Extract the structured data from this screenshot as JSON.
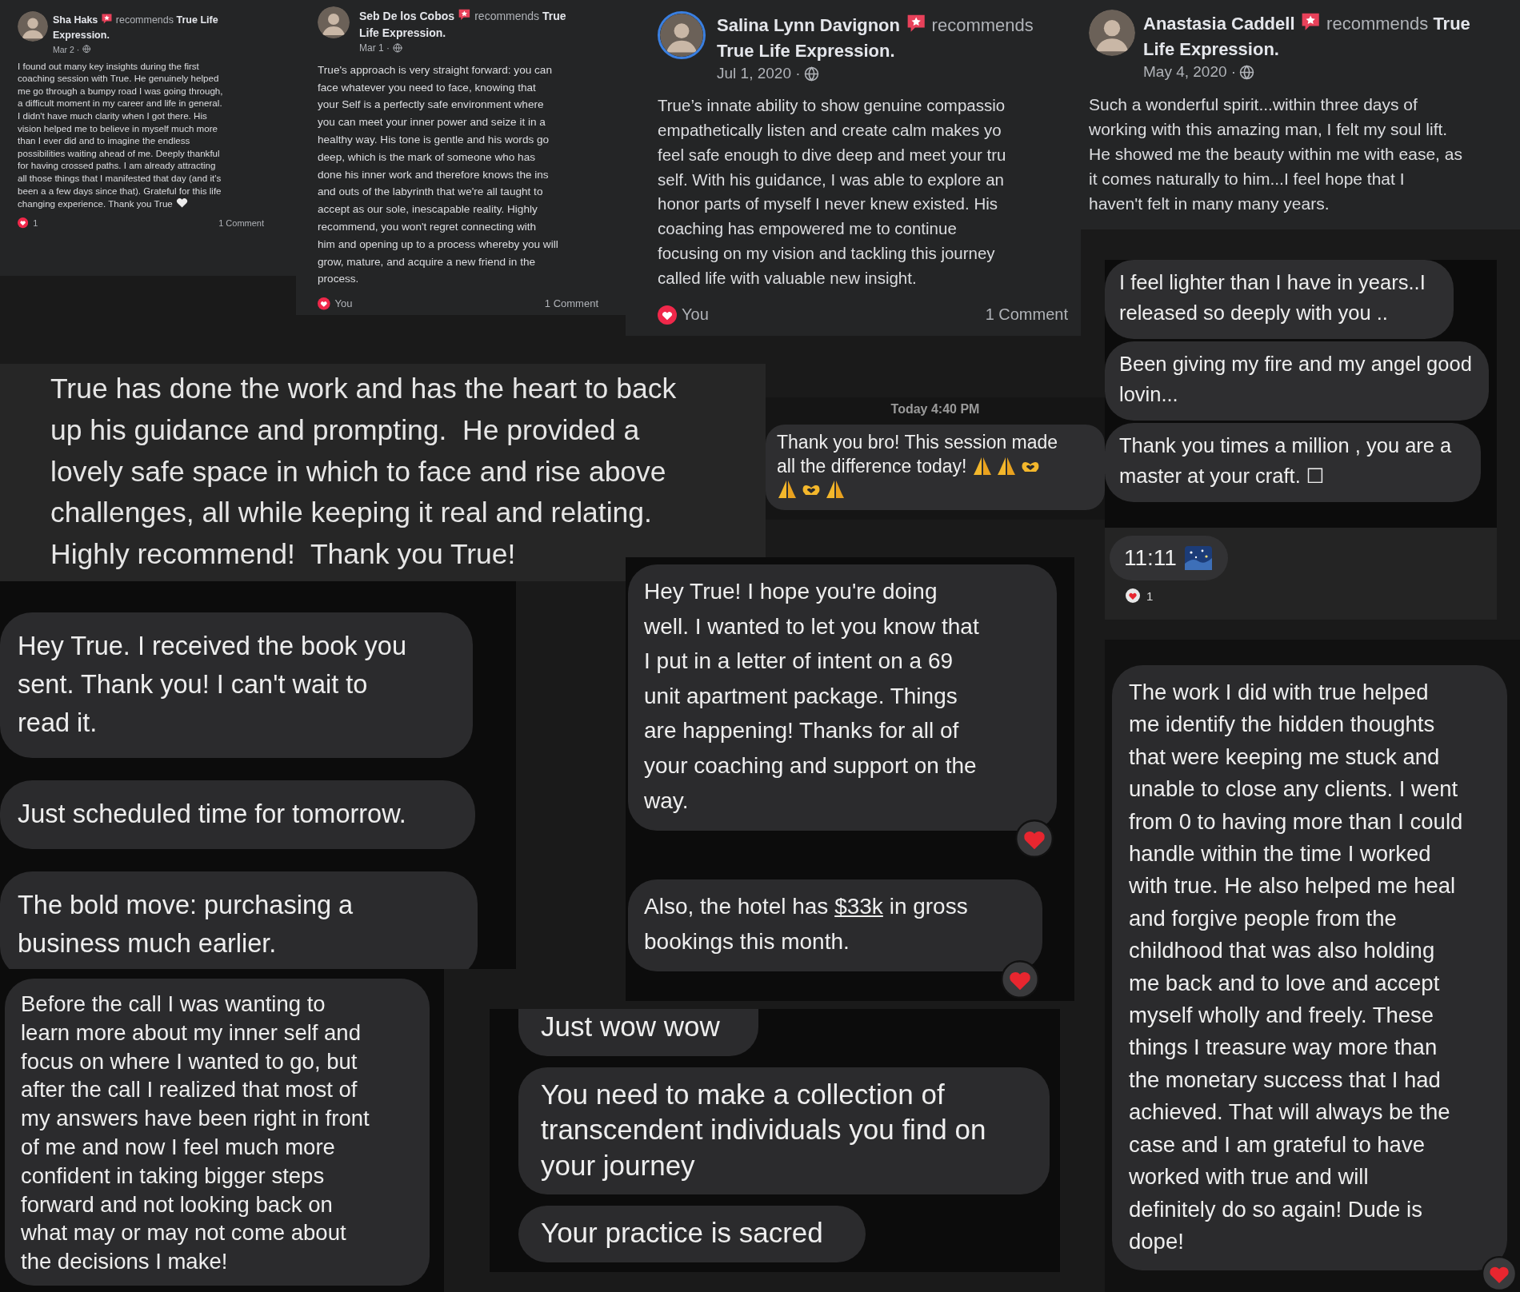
{
  "recommendations": [
    {
      "author": "Sha Haks",
      "action": "recommends **True Life**",
      "action_continued": "Expression.",
      "date": "Mar 2 ·",
      "lines": [
        "I found out many key insights during the first",
        "coaching session with True. He genuinely helped",
        "me go through a bumpy road I was going through,",
        "a difficult moment in my career and life in general.",
        "I didn't have much clarity when I got there. His",
        "vision helped me to believe in myself much more",
        "than I ever did and to imagine the endless",
        "possibilities waiting ahead of me. Deeply thankful",
        "for having crossed paths. I am already attracting",
        "all those things that I manifested that day (and it's",
        "been a a few days since that). Grateful for this life",
        "changing experience. Thank you True"
      ],
      "white_heart": true,
      "reactions": "1",
      "comments": "1 Comment",
      "avatar_ring": false
    },
    {
      "author": "Seb De los Cobos",
      "action": "recommends **True**",
      "action_continued": "Life Expression.",
      "date": "Mar 1 ·",
      "lines": [
        "True's approach is very straight forward: you can",
        "face whatever you need to face, knowing that",
        "your Self is a perfectly safe environment where",
        "you can meet your inner power and seize it in a",
        "healthy way. His tone is gentle and his words go",
        "deep, which is the mark of someone who has",
        "done his inner work and therefore knows the ins",
        "and outs of the labyrinth that we're all taught to",
        "accept as our sole, inescapable reality. Highly",
        "recommend, you won't regret connecting with",
        "him and opening up to a process whereby you will",
        "grow, mature, and acquire a new friend in the",
        "process."
      ],
      "white_heart": false,
      "reactions": "You",
      "comments": "1 Comment",
      "avatar_ring": false
    },
    {
      "author": "Salina Lynn Davignon",
      "action": "recommends",
      "action_continued": "True Life Expression.",
      "date": "Jul 1, 2020 ·",
      "lines": [
        "True’s innate ability to show genuine compassio",
        "empathetically listen and create calm makes yo",
        "feel safe enough to dive deep and meet your tru",
        "self. With his guidance, I was able to explore an",
        "honor parts of myself I never knew existed. His",
        "coaching has empowered me to continue",
        "focusing on my vision and tackling this journey",
        "called life with valuable new insight."
      ],
      "white_heart": false,
      "reactions": "You",
      "comments": "1 Comment",
      "avatar_ring": true
    },
    {
      "author": "Anastasia Caddell",
      "action": "recommends **True**",
      "action_continued": "Life Expression.",
      "date": "May 4, 2020 ·",
      "lines": [
        "Such a wonderful spirit...within three days of",
        "working with this amazing man, I felt my soul lift.",
        "He showed me the beauty within me with ease, as",
        "it comes naturally to him...I feel hope that I",
        "haven't felt in many many years."
      ],
      "white_heart": false,
      "avatar_ring": false
    }
  ],
  "top_right_messages": [
    {
      "lines": [
        "I feel lighter than I have in years..I",
        "released so deeply with you .."
      ]
    },
    {
      "lines": [
        "Been giving my fire and my angel good",
        "lovin..."
      ]
    },
    {
      "lines": [
        "Thank you times a million , you are a",
        "master at your craft. ☐"
      ]
    }
  ],
  "time_message": {
    "text": "11:11",
    "reactions": "1"
  },
  "testimonial": {
    "lines": [
      "True has done the work and has the heart to back",
      "up his guidance and prompting.  He provided a",
      "lovely safe space in which to face and rise above",
      "challenges, all while keeping it real and relating.",
      "Highly recommend!  Thank you True!"
    ]
  },
  "chat_snippet": {
    "timestamp": "Today 4:40 PM",
    "lines": [
      "Thank you bro! This session made",
      "all the difference today!"
    ],
    "emoji_rows": [
      {
        "emojis": [
          {
            "kind": "pray"
          },
          {
            "kind": "pray"
          },
          {
            "kind": "heart_hands"
          }
        ]
      },
      {
        "emojis": [
          {
            "kind": "pray"
          },
          {
            "kind": "heart_hands"
          },
          {
            "kind": "pray"
          }
        ]
      }
    ]
  },
  "left_messages": [
    {
      "lines": [
        "Hey True. I received the book you",
        "sent. Thank you! I can't wait to",
        "read it."
      ]
    },
    {
      "lines": [
        "Just scheduled time for tomorrow."
      ]
    },
    {
      "lines": [
        "The bold move: purchasing a",
        "business much earlier."
      ]
    }
  ],
  "before_call_message": {
    "lines": [
      "Before the call I was wanting to",
      "learn more about my inner self and",
      "focus on where I wanted to go, but",
      "after the call I realized that most of",
      "my answers have been right in front",
      "of me and now I feel much more",
      "confident in taking bigger steps",
      "forward and not looking back on",
      "what may or may not come about",
      "the decisions I make!"
    ]
  },
  "middle_messages": [
    {
      "lines": [
        "Hey True! I hope you're doing",
        "well. I wanted to let you know that",
        "I put in a letter of intent on a 69",
        "unit apartment package. Things",
        "are happening! Thanks for all of",
        "your coaching and support on the",
        "way."
      ],
      "hearted": true
    },
    {
      "lines": [
        {
          "text_before": "Also, the hotel has ",
          "link": "$33k",
          "text_after": " in gross"
        },
        "bookings this month."
      ],
      "hearted": true
    }
  ],
  "wow_messages": [
    {
      "lines": [
        "Just wow wow"
      ]
    },
    {
      "lines": [
        "You need to make a collection of",
        "transcendent individuals you find on",
        "your journey"
      ]
    },
    {
      "lines": [
        "Your practice is sacred"
      ]
    }
  ],
  "right_message": {
    "lines": [
      "The work I did with true helped",
      "me identify the hidden thoughts",
      "that were keeping me stuck and",
      "unable to close any clients.  I went",
      "from 0 to having more than I could",
      "handle within the time I worked",
      "with true.  He also helped me heal",
      "and forgive people from the",
      "childhood that was also holding",
      "me back and to love and accept",
      "myself wholly and freely.  These",
      "things I treasure way more than",
      "the monetary success that I had",
      "achieved.  That will always be the",
      "case and I am grateful to have",
      "worked with true and will",
      "definitely do so again!  Dude is",
      "dope!"
    ],
    "hearted": true
  }
}
